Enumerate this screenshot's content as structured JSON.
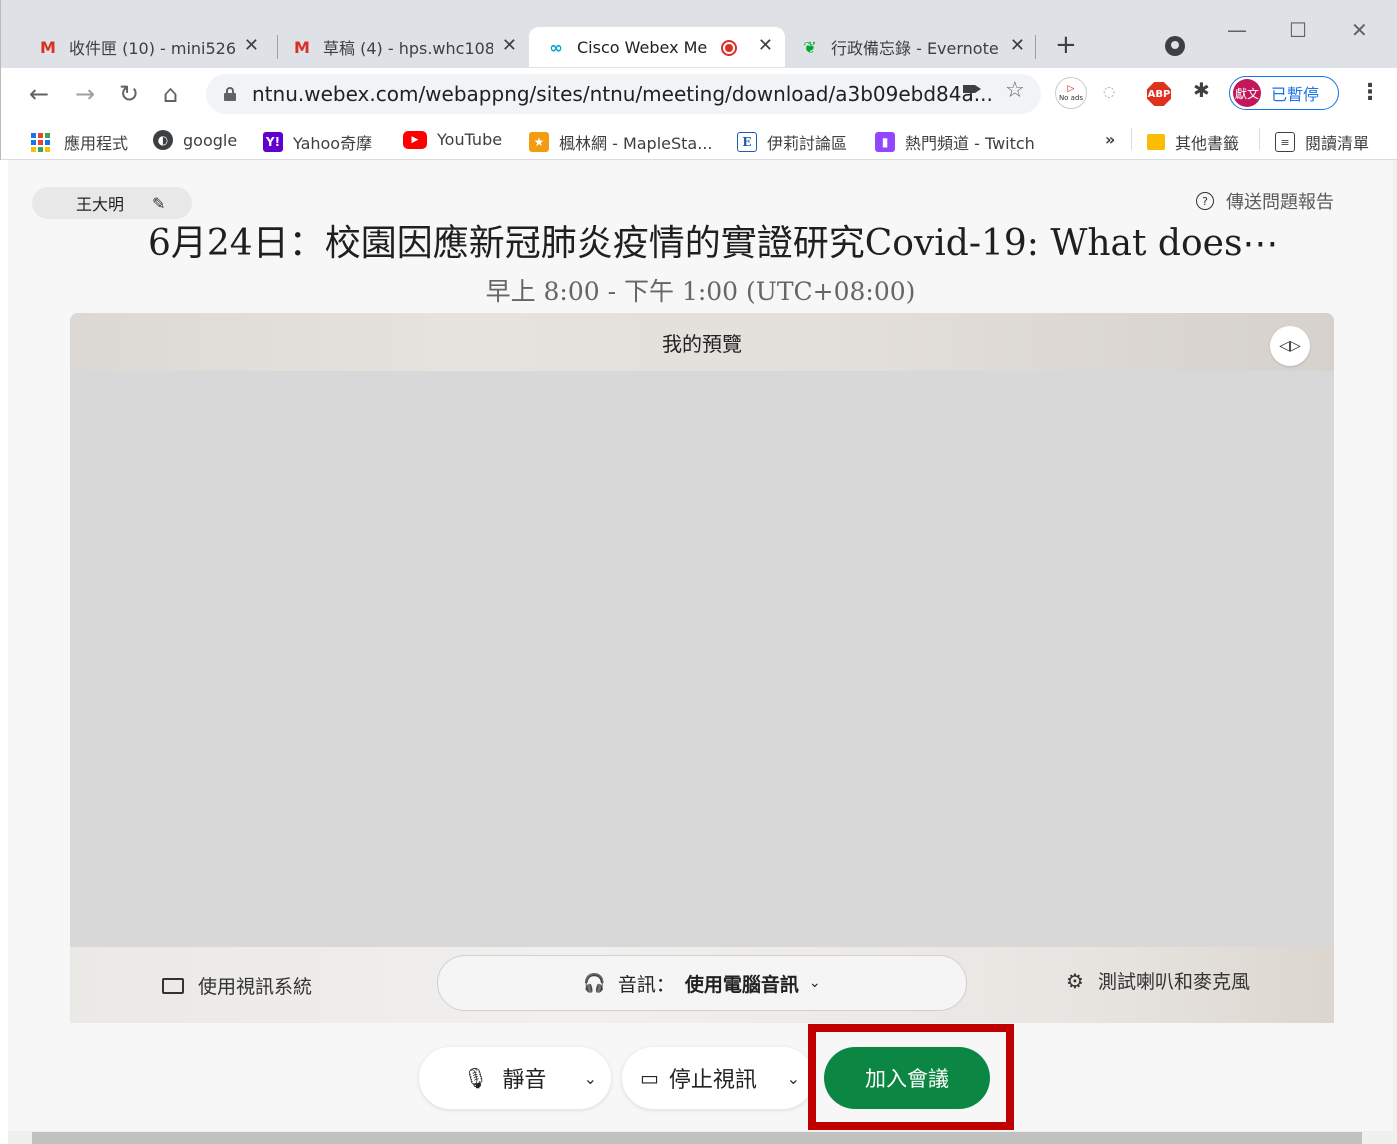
{
  "tabs": [
    {
      "favicon": "gmail-icon",
      "title": "收件匣 (10) - mini526",
      "close": "✕"
    },
    {
      "favicon": "gmail-icon",
      "title": "草稿 (4) - hps.whc108",
      "close": "✕"
    },
    {
      "favicon": "webex-icon",
      "title": "Cisco Webex Me",
      "close": "✕"
    },
    {
      "favicon": "evernote-icon",
      "title": "行政備忘錄 - Evernote",
      "close": "✕"
    }
  ],
  "toolbar": {
    "url": "ntnu.webex.com/webappng/sites/ntnu/meeting/download/a3b09ebd84a...",
    "noads_label": "No ads",
    "abp_label": "ABP",
    "profile_initials": "獻文",
    "profile_status": "已暫停"
  },
  "bookmarks": [
    {
      "icon": "apps-icon",
      "label": "應用程式"
    },
    {
      "icon": "globe-icon",
      "label": "google"
    },
    {
      "icon": "yahoo-icon",
      "label": "Yahoo奇摩"
    },
    {
      "icon": "youtube-icon",
      "label": "YouTube"
    },
    {
      "icon": "maple-icon",
      "label": "楓林網 - MapleSta..."
    },
    {
      "icon": "e-icon",
      "label": "伊莉討論區"
    },
    {
      "icon": "twitch-icon",
      "label": "熱門頻道 - Twitch"
    },
    {
      "icon": "chevron-double-icon",
      "label": "»"
    },
    {
      "icon": "folder-icon",
      "label": "其他書籤"
    },
    {
      "icon": "reading-list-icon",
      "label": "閱讀清單"
    }
  ],
  "meeting": {
    "user_name": "王大明",
    "report_label": "傳送問題報告",
    "title": "6月24日：校園因應新冠肺炎疫情的實證研究Covid-19: What does⋯",
    "time": "早上 8:00 - 下午 1:00 (UTC+08:00)",
    "preview_title": "我的預覽",
    "video_system_label": "使用視訊系統",
    "audio_label": "音訊：",
    "audio_value": "使用電腦音訊",
    "test_label": "測試喇叭和麥克風",
    "mute_label": "靜音",
    "stop_video_label": "停止視訊",
    "join_label": "加入會議"
  }
}
